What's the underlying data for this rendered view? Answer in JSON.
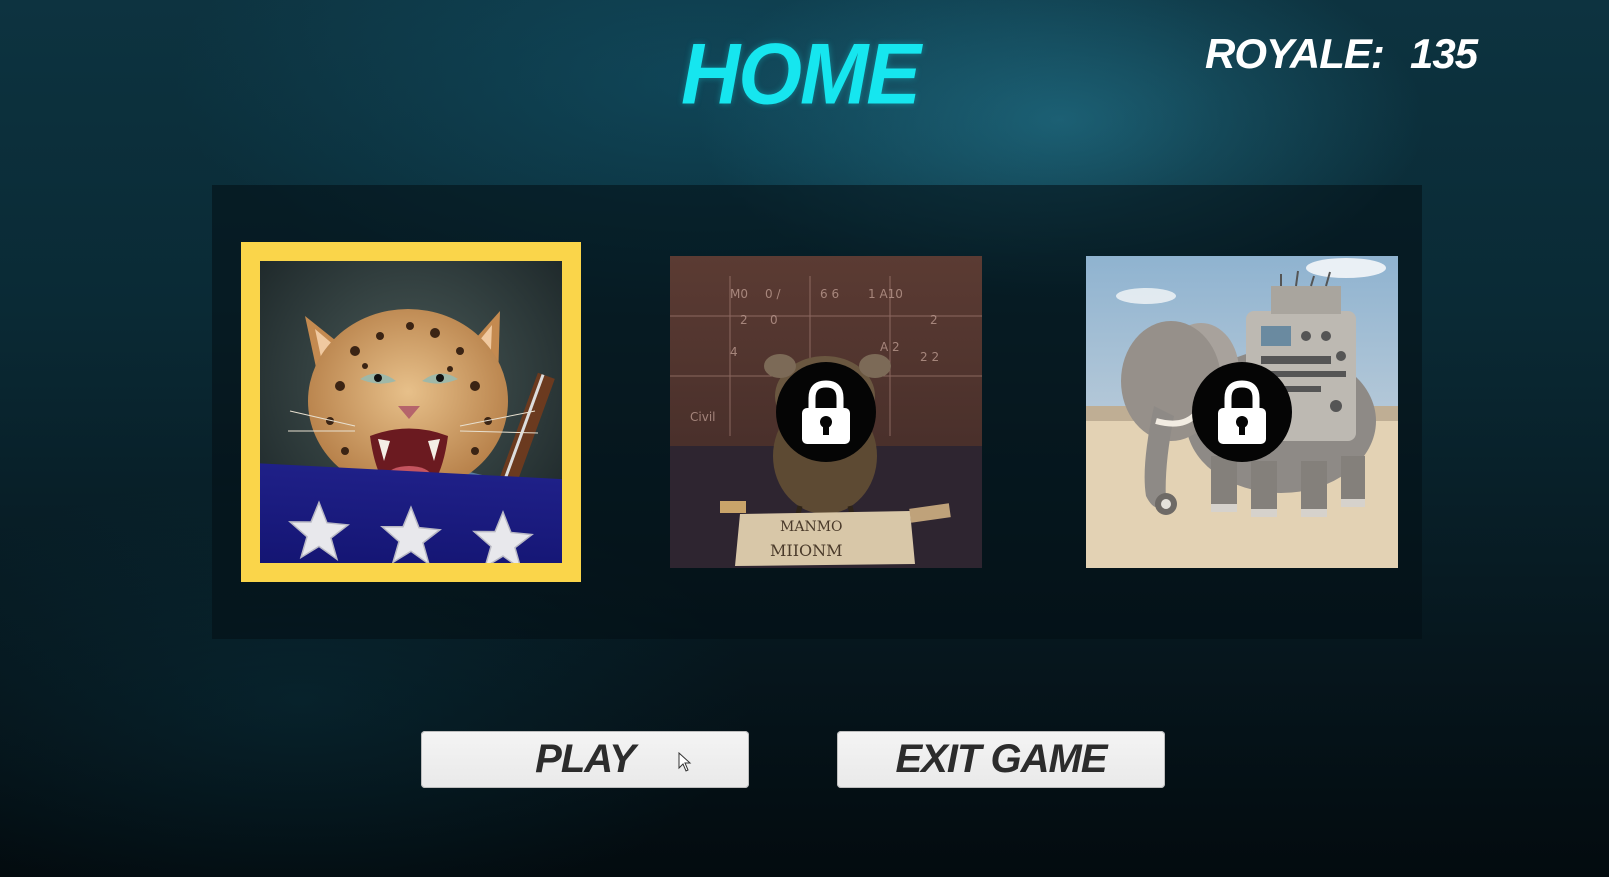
{
  "header": {
    "title": "HOME",
    "currency_label": "ROYALE:",
    "currency_value": "135"
  },
  "levels": [
    {
      "name": "rock-leopard",
      "locked": false,
      "selected": true,
      "stars": 3
    },
    {
      "name": "monster",
      "locked": true,
      "selected": false
    },
    {
      "name": "robot-elephant",
      "locked": true,
      "selected": false
    }
  ],
  "buttons": {
    "play_label": "PLAY",
    "exit_label": "EXIT GAME"
  },
  "colors": {
    "title": "#16e6ef",
    "selection_frame": "#fad54a",
    "stars_band": "#1f2088",
    "button_bg": "#eeeeee"
  },
  "icons": {
    "lock": "padlock-icon",
    "star": "star-icon",
    "cursor": "mouse-pointer-icon"
  }
}
